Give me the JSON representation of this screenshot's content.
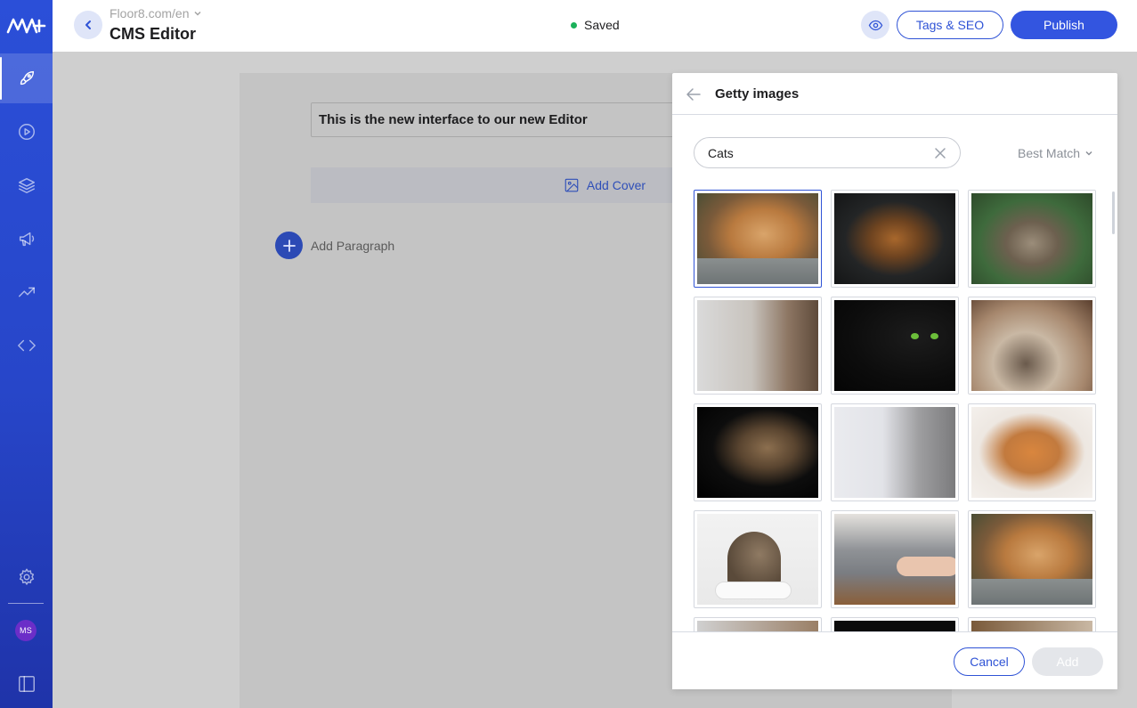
{
  "sidebar": {
    "logo": "m-plus-logo",
    "items": [
      {
        "name": "rocket-icon",
        "active": true
      },
      {
        "name": "play-circle-icon",
        "active": false
      },
      {
        "name": "layers-icon",
        "active": false
      },
      {
        "name": "megaphone-icon",
        "active": false
      },
      {
        "name": "trending-up-icon",
        "active": false
      },
      {
        "name": "code-icon",
        "active": false
      }
    ],
    "settings_icon": "gear-icon",
    "avatar_initials": "MS",
    "panel_toggle_icon": "sidebar-panel-icon"
  },
  "header": {
    "site": "Floor8.com/en",
    "title": "CMS Editor",
    "status": "Saved",
    "tags_seo_label": "Tags & SEO",
    "publish_label": "Publish"
  },
  "editor": {
    "title_text": "This is the new interface to our new Editor",
    "add_cover_label": "Add Cover",
    "add_paragraph_label": "Add Paragraph"
  },
  "panel": {
    "title": "Getty images",
    "search_value": "Cats",
    "sort_label": "Best Match",
    "images": [
      {
        "description": "orange tabby cat lying and playing",
        "selected": true
      },
      {
        "description": "tabby cat looking up on dark background",
        "selected": false
      },
      {
        "description": "tabby kitten on green background",
        "selected": false
      },
      {
        "description": "cat profile close-up on light background",
        "selected": false
      },
      {
        "description": "black cat with green eyes",
        "selected": false
      },
      {
        "description": "kitten under a pillow",
        "selected": false
      },
      {
        "description": "tabby cat portrait on black background",
        "selected": false
      },
      {
        "description": "grey cat profile on white background",
        "selected": false
      },
      {
        "description": "ginger kitten lying on white fur",
        "selected": false
      },
      {
        "description": "kitten on a white chair",
        "selected": false
      },
      {
        "description": "grey cat being petted by hand",
        "selected": false
      },
      {
        "description": "orange tabby cat lying and playing",
        "selected": false
      },
      {
        "description": "partial image row",
        "selected": false
      },
      {
        "description": "partial image row",
        "selected": false
      },
      {
        "description": "partial image row",
        "selected": false
      }
    ],
    "cancel_label": "Cancel",
    "add_label": "Add"
  },
  "colors": {
    "brand_blue": "#3355e0",
    "sidebar_blue": "#2746c9",
    "saved_green": "#1bb15a"
  }
}
